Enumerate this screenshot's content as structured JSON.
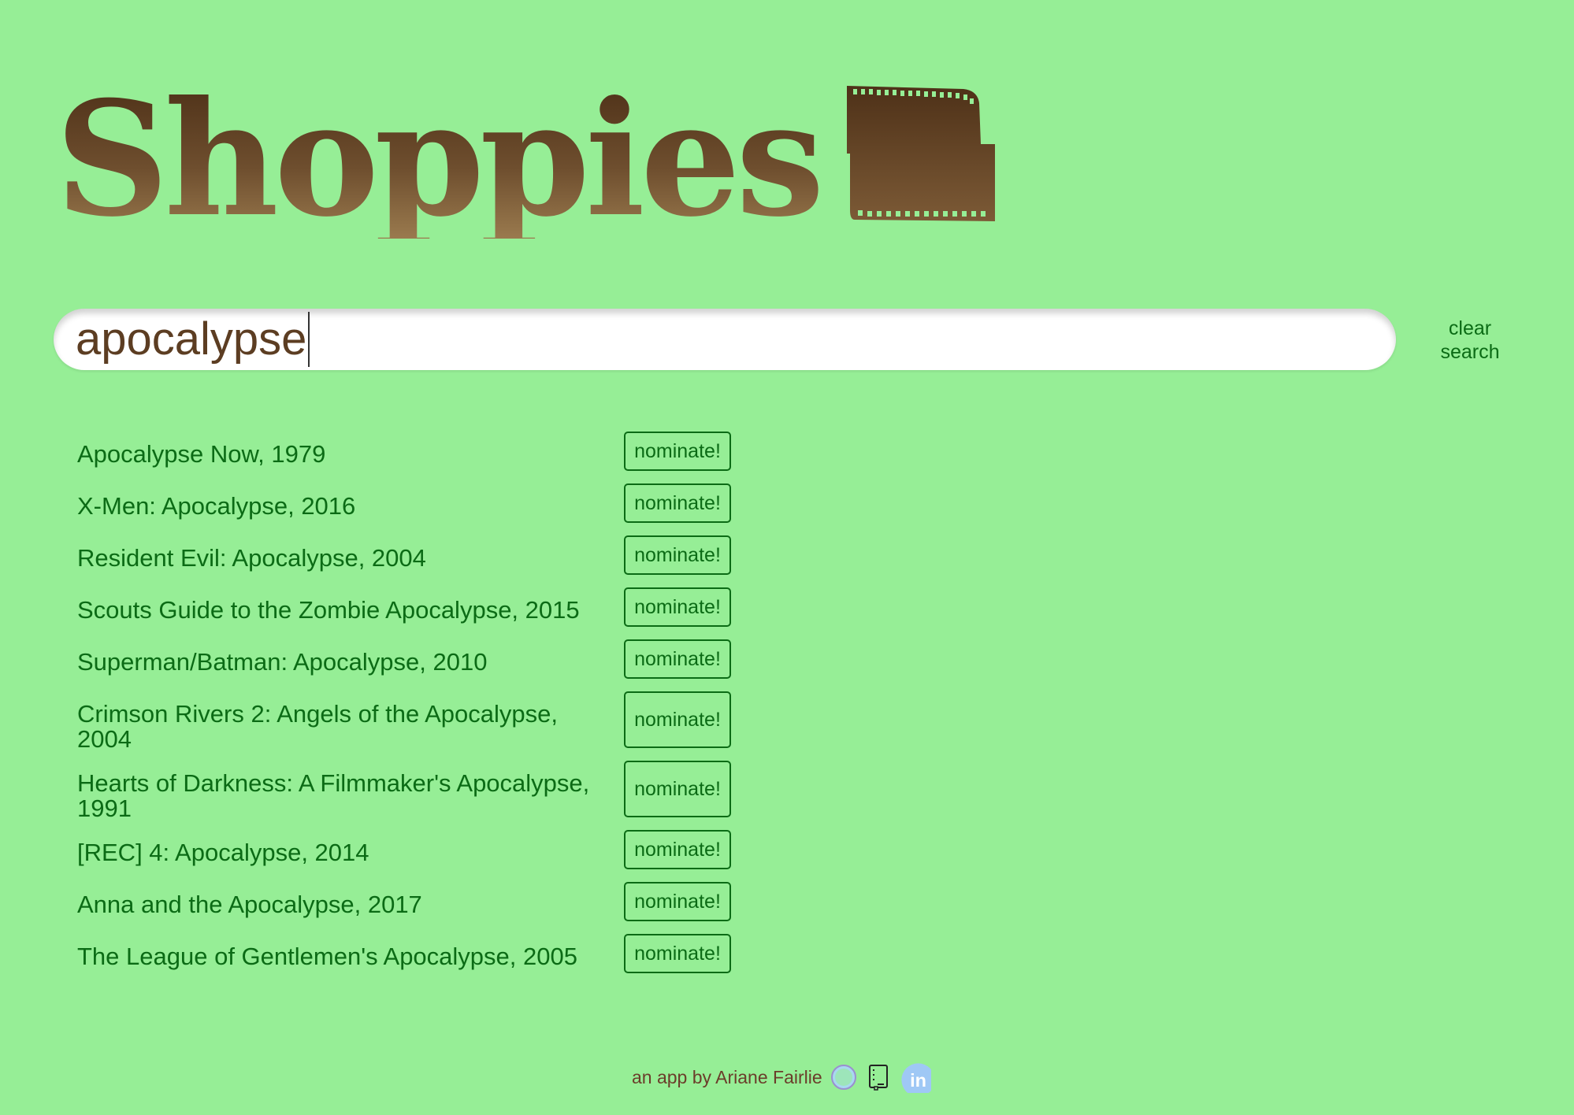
{
  "header": {
    "title": "Shoppies",
    "logo_icon": "film-strip-icon",
    "colors": {
      "gradient_top": "#4e3118",
      "gradient_bottom": "#9a7a4e"
    }
  },
  "search": {
    "value": "apocalypse",
    "clear_label_line1": "clear",
    "clear_label_line2": "search"
  },
  "results": [
    {
      "title": "Apocalypse Now, 1979",
      "button": "nominate!"
    },
    {
      "title": "X-Men: Apocalypse, 2016",
      "button": "nominate!"
    },
    {
      "title": "Resident Evil: Apocalypse, 2004",
      "button": "nominate!"
    },
    {
      "title": "Scouts Guide to the Zombie Apocalypse, 2015",
      "button": "nominate!"
    },
    {
      "title": "Superman/Batman: Apocalypse, 2010",
      "button": "nominate!"
    },
    {
      "title": "Crimson Rivers 2: Angels of the Apocalypse, 2004",
      "button": "nominate!"
    },
    {
      "title": "Hearts of Darkness: A Filmmaker's Apocalypse, 1991",
      "button": "nominate!"
    },
    {
      "title": "[REC] 4: Apocalypse, 2014",
      "button": "nominate!"
    },
    {
      "title": "Anna and the Apocalypse, 2017",
      "button": "nominate!"
    },
    {
      "title": "The League of Gentlemen's Apocalypse, 2005",
      "button": "nominate!"
    }
  ],
  "footer": {
    "credit": "an app by Ariane Fairlie",
    "icons": [
      "github-icon",
      "portfolio-icon",
      "linkedin-icon"
    ]
  },
  "colors": {
    "background": "#96ee96",
    "accent_green": "#0b6b15",
    "brown_text": "#5c3d22"
  }
}
